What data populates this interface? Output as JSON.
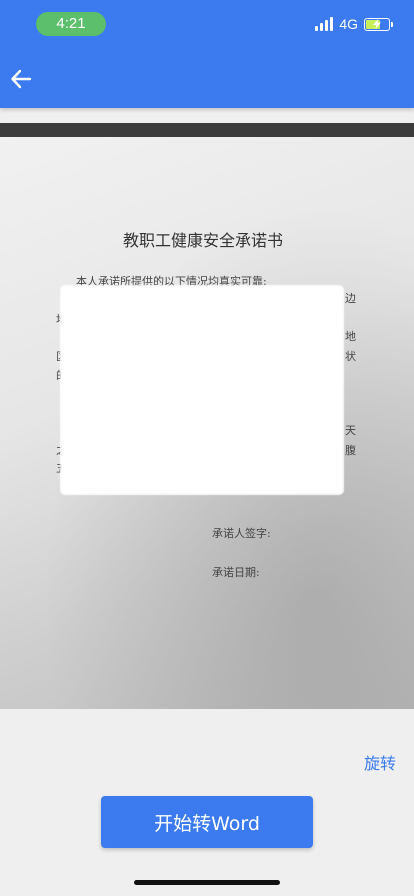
{
  "status_bar": {
    "time": "4:21",
    "network": "4G",
    "signal_icon": "signal-bars-icon",
    "battery_icon": "battery-charging-icon"
  },
  "header": {
    "back_icon": "arrow-left-icon"
  },
  "document": {
    "title": "教职工健康安全承诺书",
    "intro_line": "本人承诺所提供的以下情况均真实可靠:",
    "fragments_left": [
      "地",
      "区",
      "的",
      "之",
      "五"
    ],
    "fragments_right": [
      "边",
      "地",
      "状",
      "天",
      "腹"
    ],
    "signature_label": "承诺人签字:",
    "date_label": "承诺日期:"
  },
  "actions": {
    "rotate_label": "旋转",
    "convert_label": "开始转Word"
  },
  "colors": {
    "accent": "#3b7bef",
    "time_pill": "#5cbf6c",
    "background": "#efefef"
  }
}
